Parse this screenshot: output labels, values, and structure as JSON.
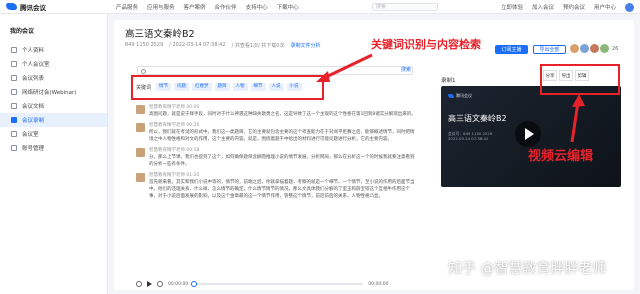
{
  "topbar": {
    "logo": "腾讯会议",
    "nav": [
      "产品服务",
      "应用与服务",
      "客户案例",
      "合作伙伴",
      "支持中心",
      "下载中心"
    ],
    "search_placeholder": "搜索",
    "right": [
      "立即体验",
      "加入会议",
      "预约会议"
    ],
    "user": "用户中心"
  },
  "sidebar": {
    "header": "我的会议",
    "items": [
      {
        "label": "个人资料"
      },
      {
        "label": "个人会议室"
      },
      {
        "label": "会议列表"
      },
      {
        "label": "网络研讨会(Webinar)"
      },
      {
        "label": "会议文档"
      },
      {
        "label": "会议录制"
      },
      {
        "label": "会议室"
      },
      {
        "label": "账号管理"
      }
    ]
  },
  "recording": {
    "title": "高三语文秦岭B2",
    "meta_id": "849 1150 2529",
    "meta_time": "/ 2022-03-14 07:38:42",
    "meta_count": "/ 共查看1次/ 共下载0次",
    "meta_link": "录制文件分析",
    "btn_join": "订阅主播",
    "btn_export": "导出全部",
    "participant_count": "26"
  },
  "colors": {
    "accent": "#1b6df5",
    "annotation": "#e8222a",
    "active_bg": "#e8f0fe"
  },
  "search_btn": "搜索",
  "keywords": {
    "label": "关键词",
    "tags": [
      "情节",
      "问题",
      "红楼梦",
      "题目",
      "人物",
      "细节",
      "人说",
      "小说"
    ]
  },
  "annotations": {
    "search": "关键词识别与内容检索",
    "video": "视频云编辑"
  },
  "transcript": [
    {
      "speaker": "智慧教育精学老师 00:00",
      "text": "高图问题，就是说于择手段，同时对于什么神遇这种缺失歌勇之名，这是导致了这一个主观的这个性格在第1回到8诸实分解现出来的。"
    },
    {
      "speaker": "智慧教育精学老师 00:26",
      "text": "所以，我们就在考试的形式中，我们这一类题目，它的主要就包含主要的这个考查能力在于对阅平拒赛之后，能够概述情节，同时把情境之中人物性格和对文的作用，这个主要的内容。就是，围绕着题干中给出的材料进行可能问题进行分析，它的主要内容。"
    },
    {
      "speaker": "智慧教育精学老师 00:58",
      "text": "分，那么上节课，我们也提到了这个，如何确保题目含糊而推理小说的情节发展，分析网局，那么在分析这一个的时候我就要注意看到的分析一些有条件。"
    },
    {
      "speaker": "智慧教育精学老师 01:20",
      "text": "首先呢来看，其实和我们小说中等的，情节的，前端之后，你就拿描着题，考察的就是一个细节，一个情节，至小说的作用的后面节当中，他们的还理关系，什么样，怎么情节的确定，什么情节情节的情况，那么文具体我们分解的了室玉和薛宝钗这个互相牛作用这个事，对于小说后面发展的影响，以及这个金章最的这一个情节作用，管整这个情节，前后前后的关系，人物性格凸显。"
    }
  ],
  "player": {
    "current": "00:00:00",
    "duration": "00:00:00"
  },
  "video": {
    "section_label": "录制1",
    "tools": [
      "分享",
      "导出",
      "剪辑"
    ],
    "logo": "腾讯会议",
    "title": "高三语文秦岭B2",
    "sub1": "会议号：849 1150 2529",
    "sub2": "2022-03-14 07:38:42"
  },
  "watermark": "知乎 @智慧教育胖胖老师"
}
